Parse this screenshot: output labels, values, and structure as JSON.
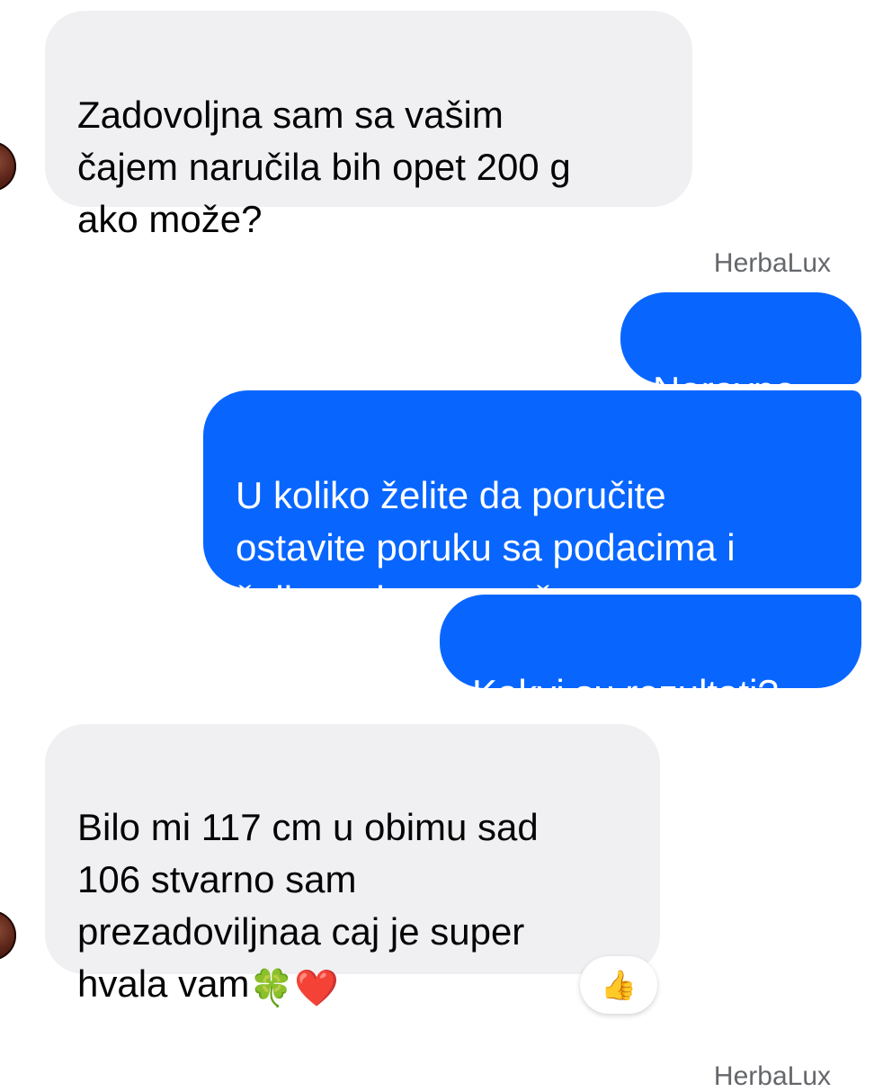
{
  "messages": [
    {
      "text": "Zadovoljna sam sa vašim\nčajem naručila bih opet 200 g\nako može?"
    },
    {
      "sender": "HerbaLux"
    },
    {
      "text": "Naravno."
    },
    {
      "text": "U koliko želite da poručite\nostavite poruku sa podacima i\nšaljemo brzom poštom."
    },
    {
      "text": "Kakvi su rezultati?"
    },
    {
      "text": "Bilo mi 117 cm u obimu sad\n106 stvarno sam\nprezadoviljnaa caj je super\nhvala vam",
      "emojis": "🍀❤️",
      "reaction": "👍"
    },
    {
      "sender": "HerbaLux"
    }
  ]
}
